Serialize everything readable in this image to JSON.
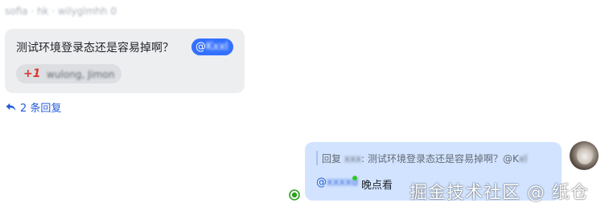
{
  "thread_message": {
    "sender_meta": "sofia · hk · wilyglmhh 0",
    "text": "测试环境登录态还是容易掉啊？",
    "mention_at": "@",
    "mention_name": "Kxxl",
    "reaction": {
      "emoji_label": "+1",
      "users": "wulong, Jimon"
    }
  },
  "reply_link": {
    "label": "2 条回复"
  },
  "own_message": {
    "quote_prefix": "回复",
    "quote_author": "xxx",
    "quote_separator": ":",
    "quote_text": "测试环境登录态还是容易掉啊？@K",
    "quote_mention_tail": "xl",
    "mention_at": "@",
    "mention_name": "xxxxd",
    "text": "晚点看"
  },
  "watermark": "掘金技术社区 @ 纸仓",
  "colors": {
    "accent": "#3370ff",
    "self_bubble": "#d1e3ff",
    "other_bubble": "#edeef0",
    "reaction_red": "#d83931",
    "online_green": "#34c724"
  },
  "icons": {
    "reply": "reply-arrow-icon",
    "read_status": "read-status-icon",
    "avatar": "avatar"
  }
}
